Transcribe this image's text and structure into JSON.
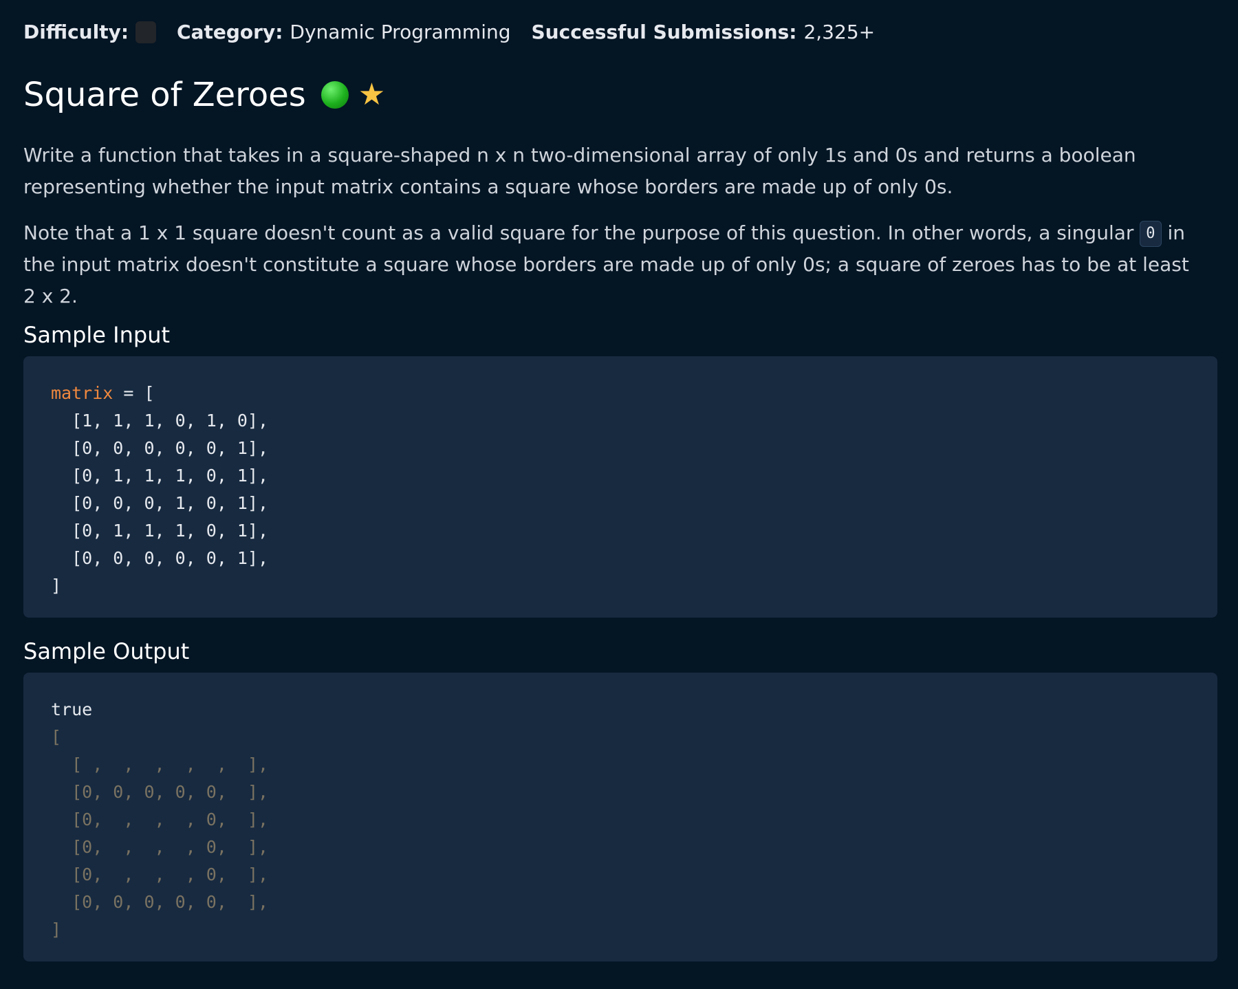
{
  "meta": {
    "difficulty_label": "Difficulty:",
    "category_label": "Category:",
    "category_value": "Dynamic Programming",
    "submissions_label": "Successful Submissions:",
    "submissions_value": "2,325+"
  },
  "title": "Square of Zeroes",
  "icons": {
    "status": "green-dot-icon",
    "favorite": "star-icon",
    "accent_green": "#1db01d",
    "accent_star": "#f8c443"
  },
  "description": {
    "p1": "Write a function that takes in a square-shaped n x n two-dimensional array of only 1s and 0s and returns a boolean representing whether the input matrix contains a square whose borders are made up of only 0s.",
    "p2_before": "Note that a 1 x 1 square doesn't count as a valid square for the purpose of this question. In other words, a singular ",
    "p2_code": "0",
    "p2_after": " in the input matrix doesn't constitute a square whose borders are made up of only 0s; a square of zeroes has to be at least 2 x 2."
  },
  "sample_input": {
    "heading": "Sample Input",
    "var_name": "matrix",
    "assign": " = [",
    "rows": [
      "  [1, 1, 1, 0, 1, 0],",
      "  [0, 0, 0, 0, 0, 1],",
      "  [0, 1, 1, 1, 0, 1],",
      "  [0, 0, 0, 1, 0, 1],",
      "  [0, 1, 1, 1, 0, 1],",
      "  [0, 0, 0, 0, 0, 1],"
    ],
    "close": "]"
  },
  "sample_output": {
    "heading": "Sample Output",
    "result": "true",
    "open": "[",
    "rows": [
      "  [ ,  ,  ,  ,  ,  ],",
      "  [0, 0, 0, 0, 0,  ],",
      "  [0,  ,  ,  , 0,  ],",
      "  [0,  ,  ,  , 0,  ],",
      "  [0,  ,  ,  , 0,  ],",
      "  [0, 0, 0, 0, 0,  ],"
    ],
    "close": "]"
  }
}
